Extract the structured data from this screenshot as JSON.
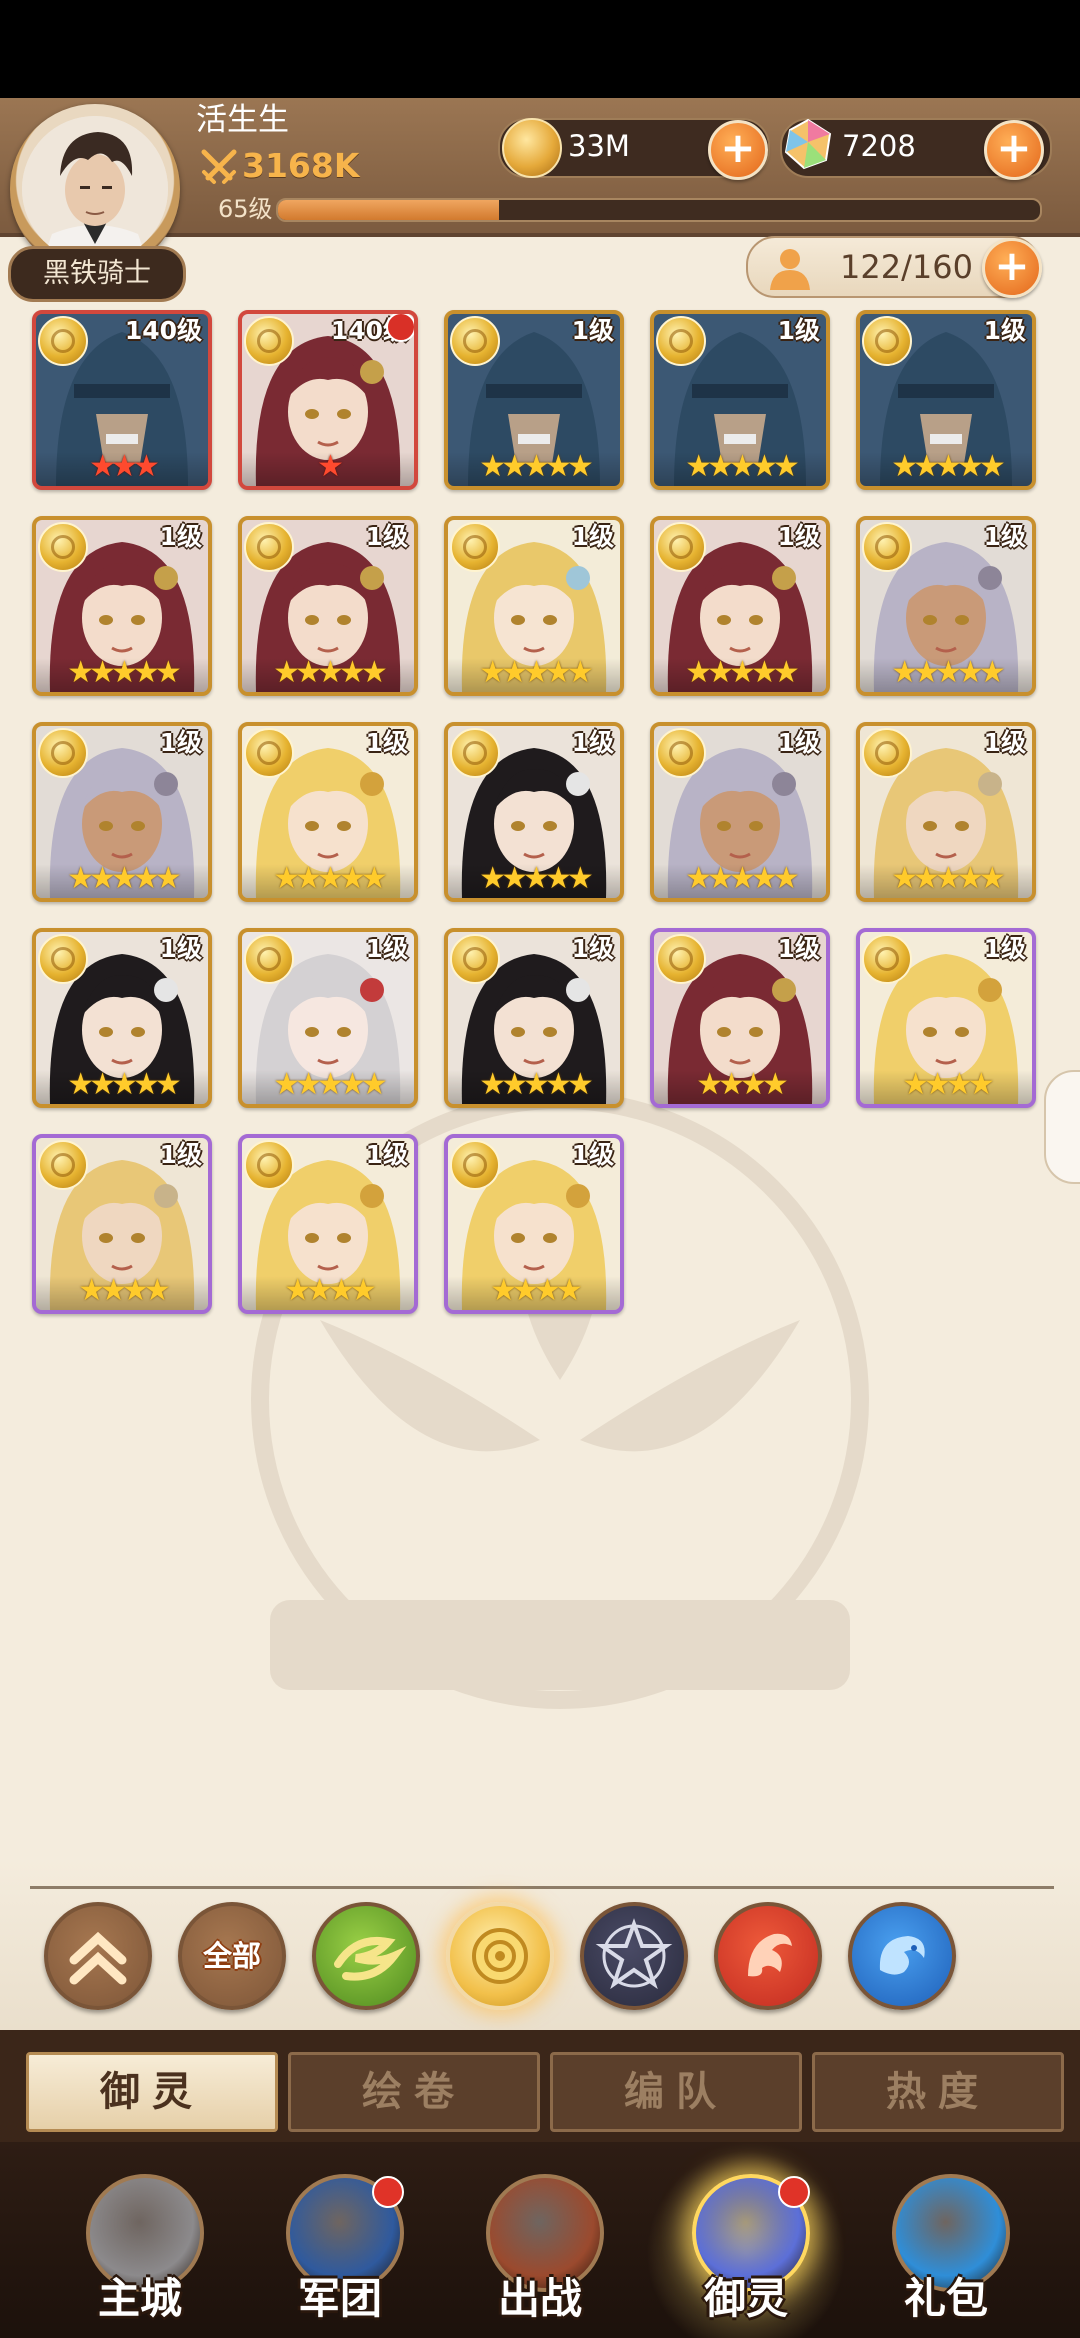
{
  "player": {
    "name": "活生生",
    "power": "3168K",
    "level": "65级",
    "xp_fraction": 0.29,
    "rank_title": "黑铁骑士"
  },
  "resources": {
    "gold": "33M",
    "gems": "7208",
    "hero_capacity": "122/160"
  },
  "add_label": "+",
  "heroes": [
    {
      "level": "140级",
      "frame": "red",
      "stars": 3,
      "star_color": "red",
      "portrait": "armored-knight",
      "notify": false
    },
    {
      "level": "140级",
      "frame": "red",
      "stars": 1,
      "star_color": "red",
      "portrait": "crimson-hair",
      "notify": true
    },
    {
      "level": "1级",
      "frame": "gold",
      "stars": 5,
      "star_color": "gold",
      "portrait": "armored-knight",
      "notify": false
    },
    {
      "level": "1级",
      "frame": "gold",
      "stars": 5,
      "star_color": "gold",
      "portrait": "armored-knight",
      "notify": false
    },
    {
      "level": "1级",
      "frame": "gold",
      "stars": 5,
      "star_color": "gold",
      "portrait": "armored-knight",
      "notify": false
    },
    {
      "level": "1级",
      "frame": "gold",
      "stars": 5,
      "star_color": "gold",
      "portrait": "crimson-hair",
      "notify": false
    },
    {
      "level": "1级",
      "frame": "gold",
      "stars": 5,
      "star_color": "gold",
      "portrait": "crimson-hair",
      "notify": false
    },
    {
      "level": "1级",
      "frame": "gold",
      "stars": 5,
      "star_color": "gold",
      "portrait": "golden-crown",
      "notify": false
    },
    {
      "level": "1级",
      "frame": "gold",
      "stars": 5,
      "star_color": "gold",
      "portrait": "crimson-hair",
      "notify": false
    },
    {
      "level": "1级",
      "frame": "gold",
      "stars": 5,
      "star_color": "gold",
      "portrait": "silver-hair-man",
      "notify": false
    },
    {
      "level": "1级",
      "frame": "gold",
      "stars": 5,
      "star_color": "gold",
      "portrait": "silver-hair-man",
      "notify": false
    },
    {
      "level": "1级",
      "frame": "gold",
      "stars": 5,
      "star_color": "gold",
      "portrait": "blonde-youth",
      "notify": false
    },
    {
      "level": "1级",
      "frame": "gold",
      "stars": 5,
      "star_color": "gold",
      "portrait": "black-hair",
      "notify": false
    },
    {
      "level": "1级",
      "frame": "gold",
      "stars": 5,
      "star_color": "gold",
      "portrait": "silver-hair-man",
      "notify": false
    },
    {
      "level": "1级",
      "frame": "gold",
      "stars": 5,
      "star_color": "gold",
      "portrait": "blonde-spiky",
      "notify": false
    },
    {
      "level": "1级",
      "frame": "gold",
      "stars": 5,
      "star_color": "gold",
      "portrait": "black-hair",
      "notify": false
    },
    {
      "level": "1级",
      "frame": "gold",
      "stars": 5,
      "star_color": "gold",
      "portrait": "white-hair-girl",
      "notify": false
    },
    {
      "level": "1级",
      "frame": "gold",
      "stars": 5,
      "star_color": "gold",
      "portrait": "black-hair",
      "notify": false
    },
    {
      "level": "1级",
      "frame": "purple",
      "stars": 4,
      "star_color": "gold",
      "portrait": "crimson-hair",
      "notify": false
    },
    {
      "level": "1级",
      "frame": "purple",
      "stars": 4,
      "star_color": "gold",
      "portrait": "blonde-youth",
      "notify": false
    },
    {
      "level": "1级",
      "frame": "purple",
      "stars": 4,
      "star_color": "gold",
      "portrait": "blonde-spiky",
      "notify": false
    },
    {
      "level": "1级",
      "frame": "purple",
      "stars": 4,
      "star_color": "gold",
      "portrait": "blonde-youth",
      "notify": false
    },
    {
      "level": "1级",
      "frame": "purple",
      "stars": 4,
      "star_color": "gold",
      "portrait": "blonde-youth",
      "notify": false
    }
  ],
  "portrait_colors": {
    "armored-knight": {
      "hair": "#2d4a63",
      "skin": "#b8a088",
      "bg": "#3c5874",
      "accent": "#1e3347"
    },
    "crimson-hair": {
      "hair": "#7a2a33",
      "skin": "#f3dccb",
      "bg": "#e7d6d0",
      "accent": "#c5a04a"
    },
    "golden-crown": {
      "hair": "#e9c86a",
      "skin": "#f6e4d2",
      "bg": "#f3ecd8",
      "accent": "#9fc6d8"
    },
    "silver-hair-man": {
      "hair": "#b8b3c6",
      "skin": "#c99a78",
      "bg": "#e2dcd6",
      "accent": "#8d8598"
    },
    "blonde-youth": {
      "hair": "#f0cf6a",
      "skin": "#f6e1cd",
      "bg": "#f4ecd9",
      "accent": "#d3a23c"
    },
    "black-hair": {
      "hair": "#1f1b1d",
      "skin": "#f3e1d3",
      "bg": "#ebe3da",
      "accent": "#e5e5e5"
    },
    "blonde-spiky": {
      "hair": "#e8c777",
      "skin": "#efd7c0",
      "bg": "#efe6d5",
      "accent": "#c8b38a"
    },
    "white-hair-girl": {
      "hair": "#d4d1d3",
      "skin": "#f6e7e0",
      "bg": "#ebe6e4",
      "accent": "#c23b3b"
    }
  },
  "filters": [
    {
      "label": "",
      "icon": "chevron-up-icon",
      "color": "#7e5638"
    },
    {
      "label": "全部",
      "icon": "",
      "color": "#7e5638"
    },
    {
      "label": "",
      "icon": "leaf-wind-icon",
      "color": "#4f8a1f"
    },
    {
      "label": "",
      "icon": "golden-rose-icon",
      "color": "#f2c04a"
    },
    {
      "label": "",
      "icon": "dark-star-icon",
      "color": "#2a2b3d"
    },
    {
      "label": "",
      "icon": "phoenix-icon",
      "color": "#c22a20"
    },
    {
      "label": "",
      "icon": "water-dragon-icon",
      "color": "#1e5fb8"
    }
  ],
  "tabs": [
    {
      "label": "御灵",
      "active": true
    },
    {
      "label": "绘卷",
      "active": false
    },
    {
      "label": "编队",
      "active": false
    },
    {
      "label": "热度",
      "active": false
    }
  ],
  "nav": [
    {
      "label": "主城",
      "icon": "castle-statue-icon",
      "notify": false,
      "active": false,
      "color": "#8c8a8c"
    },
    {
      "label": "军团",
      "icon": "shield-fist-icon",
      "notify": true,
      "active": false,
      "color": "#2f5a9e"
    },
    {
      "label": "出战",
      "icon": "battle-gate-icon",
      "notify": false,
      "active": false,
      "color": "#9b4a2e"
    },
    {
      "label": "御灵",
      "icon": "crystal-icon",
      "notify": true,
      "active": true,
      "color": "#5c6fd8"
    },
    {
      "label": "礼包",
      "icon": "gift-shop-icon",
      "notify": false,
      "active": false,
      "color": "#2f8ed8"
    }
  ]
}
